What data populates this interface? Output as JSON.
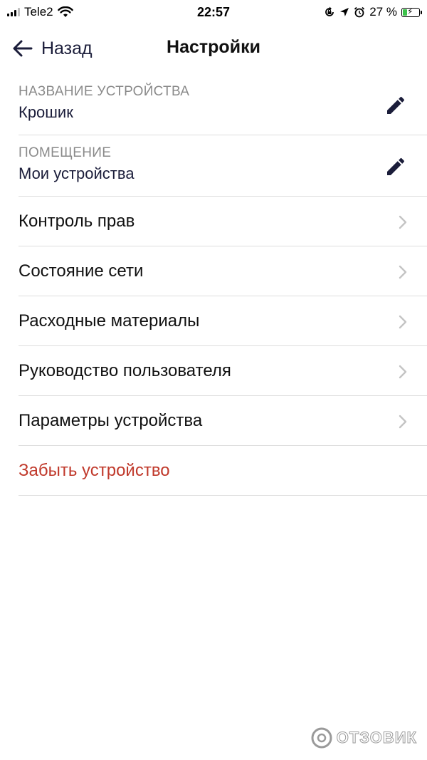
{
  "status_bar": {
    "carrier": "Tele2",
    "time": "22:57",
    "battery_percent": "27 %",
    "battery_level": 0.27,
    "icons": [
      "signal-icon",
      "wifi-icon",
      "rotation-lock-icon",
      "location-icon",
      "alarm-icon",
      "battery-icon"
    ]
  },
  "nav": {
    "back_label": "Назад",
    "title": "Настройки"
  },
  "fields": [
    {
      "label": "НАЗВАНИЕ УСТРОЙСТВА",
      "value": "Крошик",
      "icon": "pencil-icon"
    },
    {
      "label": "ПОМЕЩЕНИЕ",
      "value": "Мои устройства",
      "icon": "pencil-icon"
    }
  ],
  "menu_items": [
    {
      "label": "Контроль прав"
    },
    {
      "label": "Состояние сети"
    },
    {
      "label": "Расходные материалы"
    },
    {
      "label": "Руководство пользователя"
    },
    {
      "label": "Параметры устройства"
    }
  ],
  "forget_device": {
    "label": "Забыть устройство",
    "color": "#c0392b"
  },
  "watermark": {
    "text": "ОТЗОВИК"
  },
  "colors": {
    "accent_text": "#1b1d3a",
    "danger": "#c0392b",
    "battery_charging": "#3cc24b",
    "divider": "#dedede"
  }
}
